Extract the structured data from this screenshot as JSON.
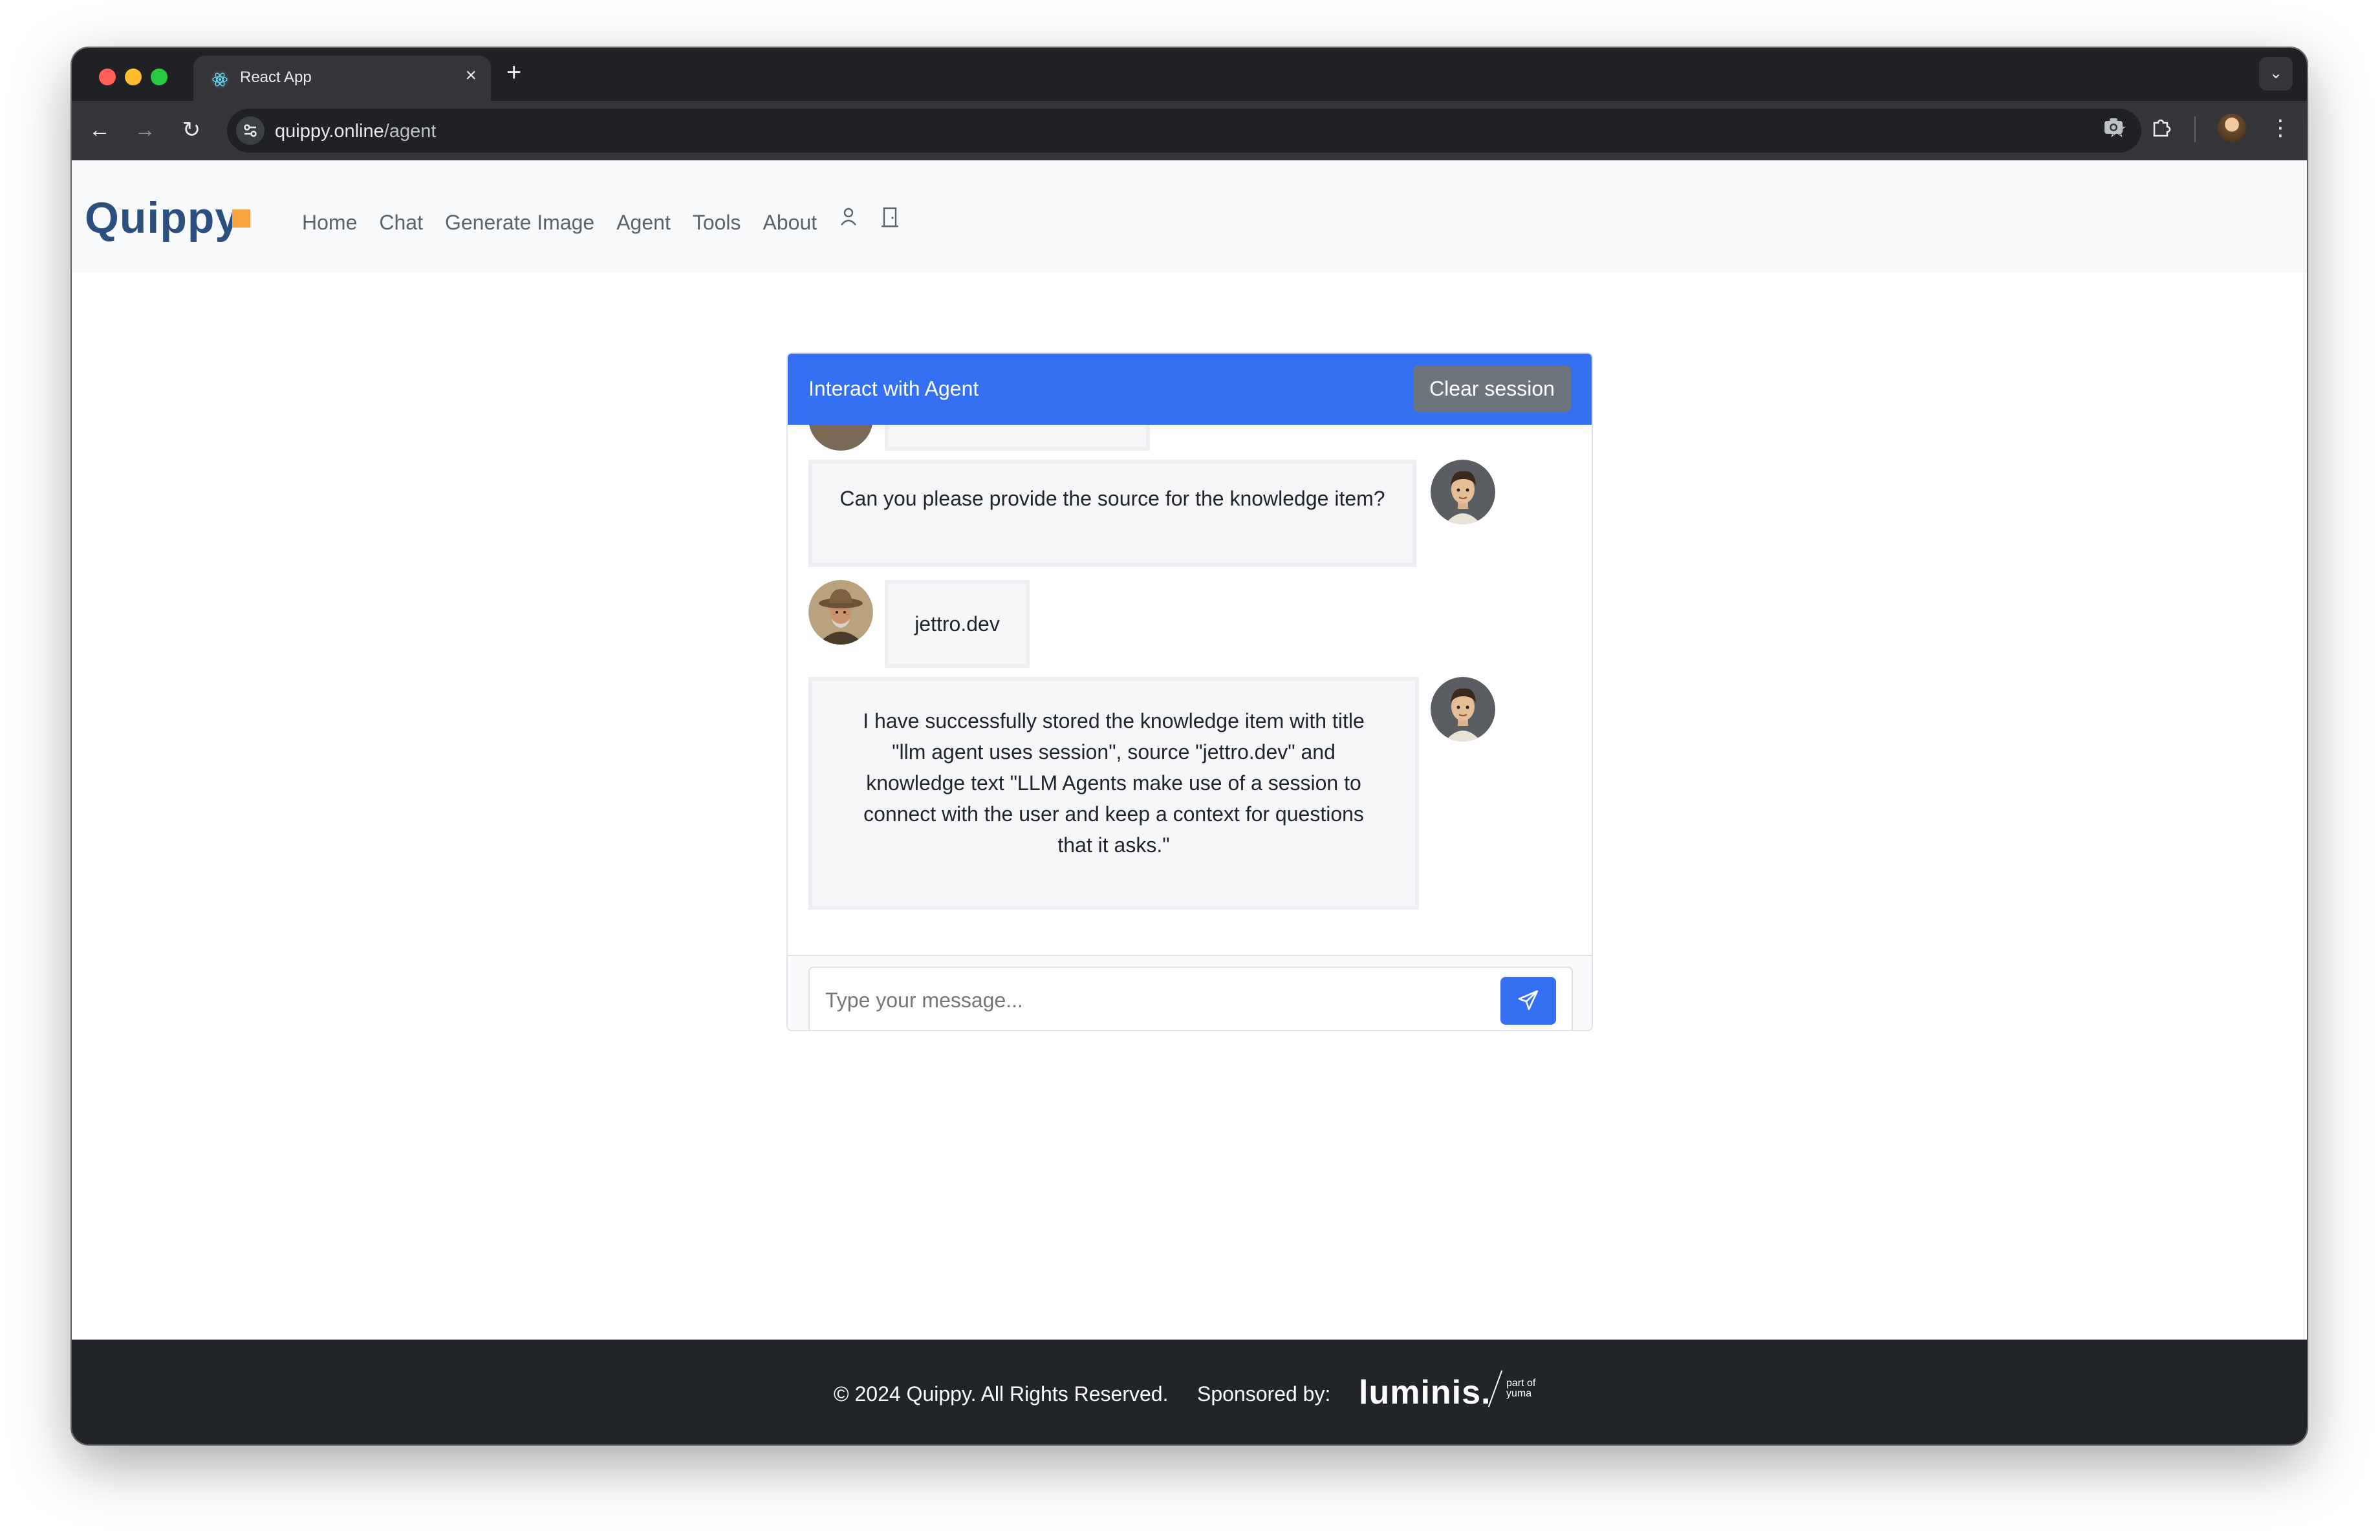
{
  "browser": {
    "tab_title": "React App",
    "url_host": "quippy.online",
    "url_path": "/agent"
  },
  "navbar": {
    "brand": "Quippy",
    "links": [
      "Home",
      "Chat",
      "Generate Image",
      "Agent",
      "Tools",
      "About"
    ],
    "icons": [
      "person-icon",
      "door-icon"
    ]
  },
  "card": {
    "title": "Interact with Agent",
    "clear_label": "Clear session"
  },
  "messages": [
    {
      "sender": "agent",
      "text": "Can you please provide the source for the knowledge item?"
    },
    {
      "sender": "user",
      "text": "jettro.dev"
    },
    {
      "sender": "agent",
      "text": "I have successfully stored the knowledge item with title \"llm agent uses session\", source \"jettro.dev\" and knowledge text \"LLM Agents make use of a session to connect with the user and keep a context for questions that it asks.\""
    }
  ],
  "input": {
    "placeholder": "Type your message..."
  },
  "footer": {
    "copyright": "© 2024 Quippy. All Rights Reserved.",
    "sponsored": "Sponsored by:",
    "sponsor_logo": "luminis.",
    "sponsor_sub": "part of\nyuma"
  },
  "colors": {
    "primary": "#3570f3",
    "secondary": "#6c757d",
    "footer": "#212529",
    "brand": "#2b4f7e",
    "accent": "#f7a440"
  }
}
